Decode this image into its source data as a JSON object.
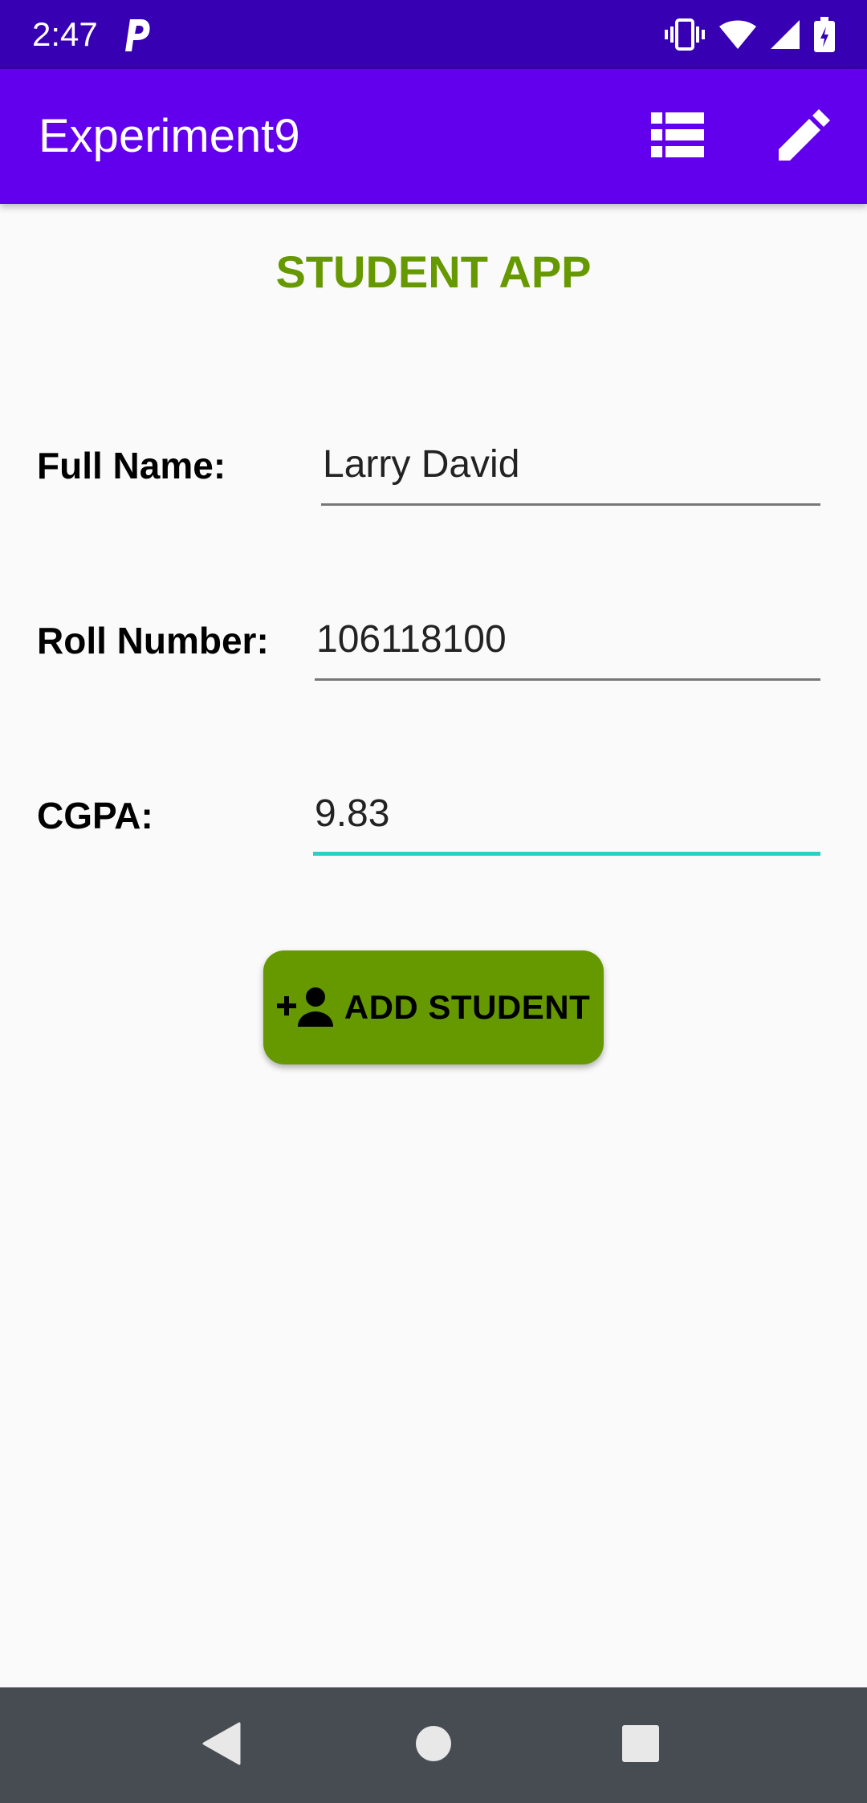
{
  "status_bar": {
    "time": "2:47",
    "icons": [
      "p-notification-icon",
      "vibrate-icon",
      "wifi-icon",
      "cell-signal-icon",
      "battery-icon"
    ]
  },
  "app_bar": {
    "title": "Experiment9",
    "actions": [
      "list-icon",
      "edit-pencil-icon"
    ],
    "background": "#6200ee"
  },
  "page": {
    "title": "STUDENT APP",
    "title_color": "#669900"
  },
  "form": {
    "full_name": {
      "label": "Full Name:",
      "value": "Larry David"
    },
    "roll_number": {
      "label": "Roll Number:",
      "value": "106118100"
    },
    "cgpa": {
      "label": "CGPA:",
      "value": "9.83",
      "focused": true
    }
  },
  "add_button": {
    "label": "ADD STUDENT",
    "icon": "person-add-icon",
    "color": "#669900"
  },
  "nav_bar": {
    "buttons": [
      "back-icon",
      "home-icon",
      "recents-icon"
    ]
  }
}
